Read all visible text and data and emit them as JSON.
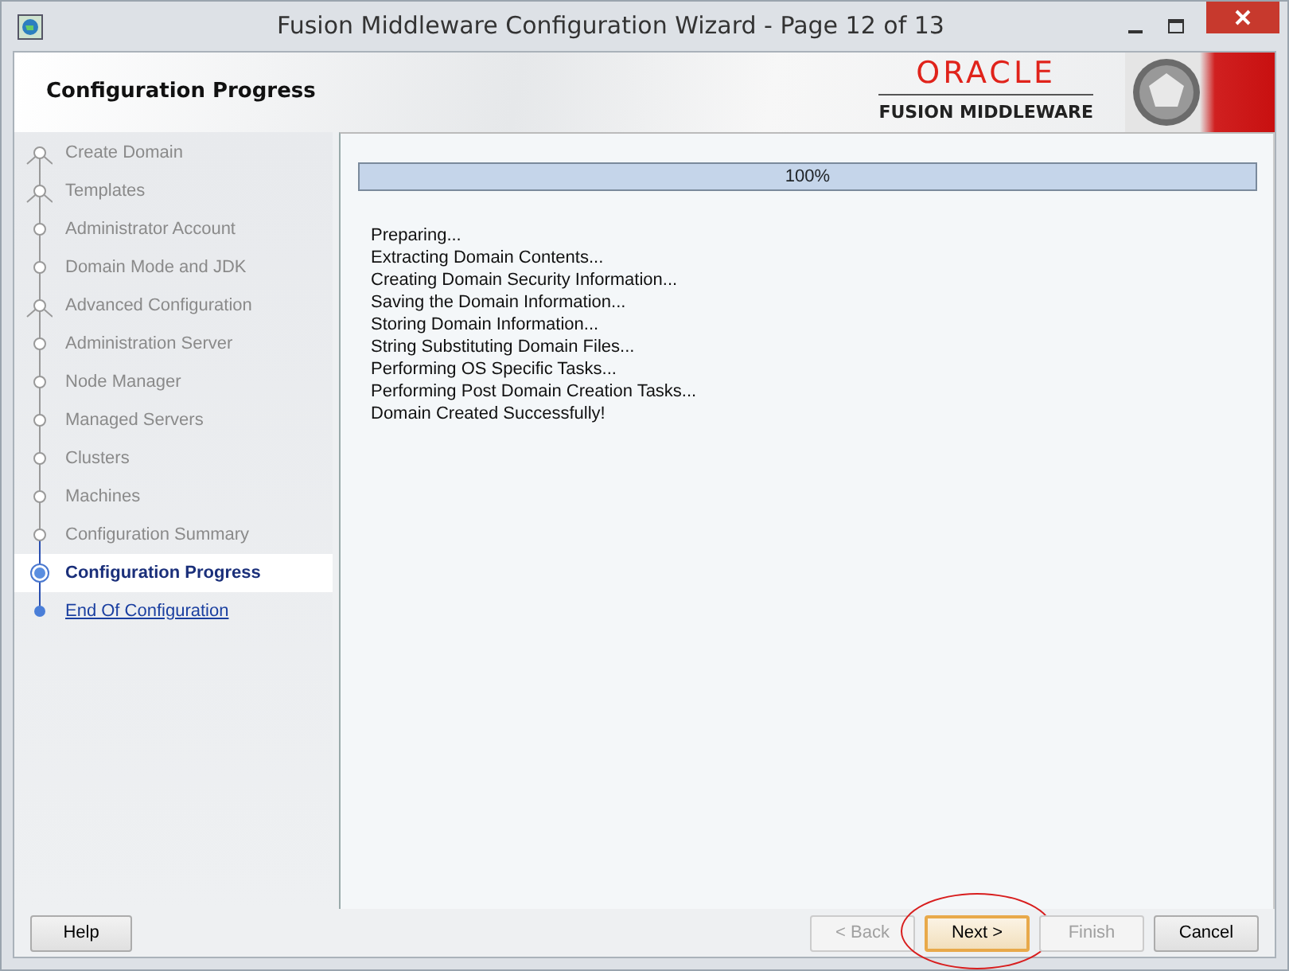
{
  "window": {
    "title": "Fusion Middleware Configuration Wizard - Page 12 of 13"
  },
  "header": {
    "title": "Configuration Progress",
    "logo_top": "ORACLE",
    "logo_bottom": "FUSION MIDDLEWARE"
  },
  "steps": [
    {
      "label": "Create Domain",
      "kind": "branch",
      "visited": true,
      "selected": false
    },
    {
      "label": "Templates",
      "kind": "branch",
      "visited": true,
      "selected": false
    },
    {
      "label": "Administrator Account",
      "kind": "step",
      "visited": true,
      "selected": false
    },
    {
      "label": "Domain Mode and JDK",
      "kind": "step",
      "visited": true,
      "selected": false
    },
    {
      "label": "Advanced Configuration",
      "kind": "branch",
      "visited": true,
      "selected": false
    },
    {
      "label": "Administration Server",
      "kind": "step",
      "visited": true,
      "selected": false
    },
    {
      "label": "Node Manager",
      "kind": "step",
      "visited": true,
      "selected": false
    },
    {
      "label": "Managed Servers",
      "kind": "step",
      "visited": true,
      "selected": false
    },
    {
      "label": "Clusters",
      "kind": "step",
      "visited": true,
      "selected": false
    },
    {
      "label": "Machines",
      "kind": "step",
      "visited": true,
      "selected": false
    },
    {
      "label": "Configuration Summary",
      "kind": "step",
      "visited": true,
      "selected": false
    },
    {
      "label": "Configuration Progress",
      "kind": "step",
      "visited": false,
      "selected": true
    },
    {
      "label": "End Of Configuration",
      "kind": "step",
      "visited": false,
      "selected": false
    }
  ],
  "progress": {
    "level": 1,
    "reading": "100%"
  },
  "log": [
    "Preparing...",
    "Extracting Domain Contents...",
    "Creating Domain Security Information...",
    "Saving the Domain Information...",
    "Storing Domain Information...",
    "String Substituting Domain Files...",
    "Performing OS Specific Tasks...",
    "Performing Post Domain Creation Tasks...",
    "Domain Created Successfully!"
  ],
  "buttons": [
    {
      "label": "Help",
      "disabled": false,
      "focused": false,
      "circled": false
    },
    {
      "label": "< Back",
      "disabled": true,
      "focused": false,
      "circled": false
    },
    {
      "label": "Next >",
      "disabled": false,
      "focused": true,
      "circled": true
    },
    {
      "label": "Finish",
      "disabled": true,
      "focused": false,
      "circled": false
    },
    {
      "label": "Cancel",
      "disabled": false,
      "focused": false,
      "circled": false
    }
  ]
}
